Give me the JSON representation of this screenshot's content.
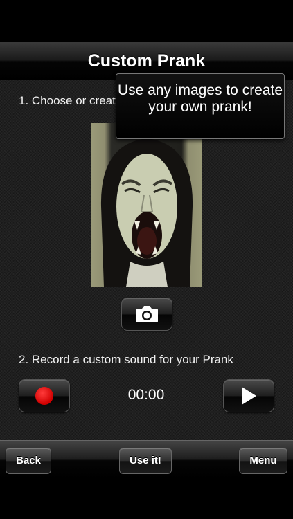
{
  "nav": {
    "title": "Custom Prank"
  },
  "steps": {
    "step1_label": "1. Choose or create",
    "step2_label": "2. Record a custom sound for your Prank"
  },
  "tooltip": {
    "text": "Use any images to create your own prank!"
  },
  "recorder": {
    "time": "00:00"
  },
  "icons": {
    "camera": "camera-icon",
    "record": "record-icon",
    "play": "play-icon"
  },
  "toolbar": {
    "back_label": "Back",
    "use_label": "Use it!",
    "menu_label": "Menu"
  },
  "colors": {
    "record_dot": "#e00000",
    "background": "#1f1f1f"
  }
}
